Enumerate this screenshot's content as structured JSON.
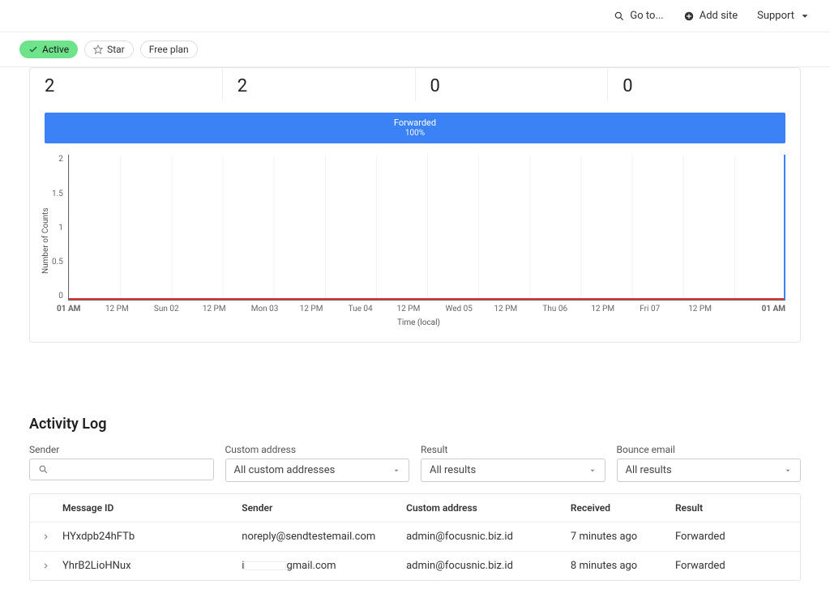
{
  "topnav": {
    "goto": "Go to...",
    "add_site": "Add site",
    "support": "Support"
  },
  "pills": {
    "active": "Active",
    "star": "Star",
    "plan": "Free plan"
  },
  "stats": {
    "values": [
      "2",
      "2",
      "0",
      "0"
    ],
    "forwarded_label": "Forwarded",
    "forwarded_pct": "100%"
  },
  "chart_data": {
    "type": "line",
    "title": "",
    "ylabel": "Number of Counts",
    "xlabel": "Time (local)",
    "ylim": [
      0,
      2
    ],
    "y_ticks": [
      "2",
      "1.5",
      "1",
      "0.5",
      "0"
    ],
    "x_ticks": [
      "01 AM",
      "12 PM",
      "Sun 02",
      "12 PM",
      "Mon 03",
      "12 PM",
      "Tue 04",
      "12 PM",
      "Wed 05",
      "12 PM",
      "Thu 06",
      "12 PM",
      "Fri 07",
      "12 PM",
      "01 AM"
    ],
    "series": [
      {
        "name": "forwarded",
        "values": [
          0,
          0,
          0,
          0,
          0,
          0,
          0,
          0,
          0,
          0,
          0,
          0,
          0,
          0,
          2
        ]
      }
    ]
  },
  "activity": {
    "title": "Activity Log",
    "filters": {
      "sender_label": "Sender",
      "custom_label": "Custom address",
      "custom_value": "All custom addresses",
      "result_label": "Result",
      "result_value": "All results",
      "bounce_label": "Bounce email",
      "bounce_value": "All results"
    },
    "headers": {
      "msgid": "Message ID",
      "sender": "Sender",
      "custom": "Custom address",
      "received": "Received",
      "result": "Result"
    },
    "rows": [
      {
        "msgid": "HYxdpb24hFTb",
        "sender": "noreply@sendtestemail.com",
        "custom": "admin@focusnic.biz.id",
        "received": "7 minutes ago",
        "result": "Forwarded"
      },
      {
        "msgid": "YhrB2LioHNux",
        "sender_prefix": "i",
        "sender_suffix": "gmail.com",
        "custom": "admin@focusnic.biz.id",
        "received": "8 minutes ago",
        "result": "Forwarded"
      }
    ]
  }
}
